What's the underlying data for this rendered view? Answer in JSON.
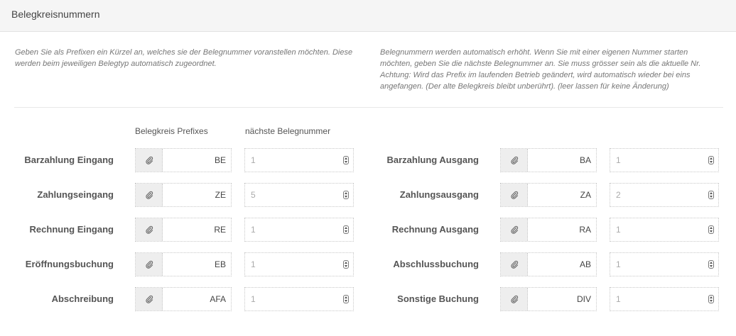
{
  "panel": {
    "title": "Belegkreisnummern"
  },
  "help": {
    "left": "Geben Sie als Prefixen ein Kürzel an, welches sie der Belegnummer voranstellen möchten. Diese werden beim jeweiligen Belegtyp automatisch zugeordnet.",
    "right": "Belegnummern werden automatisch erhöht. Wenn Sie mit einer eigenen Nummer starten möchten, geben Sie die nächste Belegnummer an. Sie muss grösser sein als die aktuelle Nr. Achtung: Wird das Prefix im laufenden Betrieb geändert, wird automatisch wieder bei eins angefangen. (Der alte Belegkreis bleibt unberührt). (leer lassen für keine Änderung)"
  },
  "columns": {
    "prefix": "Belegkreis Prefixes",
    "next": "nächste Belegnummer"
  },
  "icons": {
    "addon": "paperclip-icon",
    "spinner": "number-spinner-icon"
  },
  "left_rows": [
    {
      "label": "Barzahlung Eingang",
      "prefix": "BE",
      "next_placeholder": "1"
    },
    {
      "label": "Zahlungseingang",
      "prefix": "ZE",
      "next_placeholder": "5"
    },
    {
      "label": "Rechnung Eingang",
      "prefix": "RE",
      "next_placeholder": "1"
    },
    {
      "label": "Eröffnungsbuchung",
      "prefix": "EB",
      "next_placeholder": "1"
    },
    {
      "label": "Abschreibung",
      "prefix": "AFA",
      "next_placeholder": "1"
    }
  ],
  "right_rows": [
    {
      "label": "Barzahlung Ausgang",
      "prefix": "BA",
      "next_placeholder": "1"
    },
    {
      "label": "Zahlungsausgang",
      "prefix": "ZA",
      "next_placeholder": "2"
    },
    {
      "label": "Rechnung Ausgang",
      "prefix": "RA",
      "next_placeholder": "1"
    },
    {
      "label": "Abschlussbuchung",
      "prefix": "AB",
      "next_placeholder": "1"
    },
    {
      "label": "Sonstige Buchung",
      "prefix": "DIV",
      "next_placeholder": "1"
    }
  ]
}
